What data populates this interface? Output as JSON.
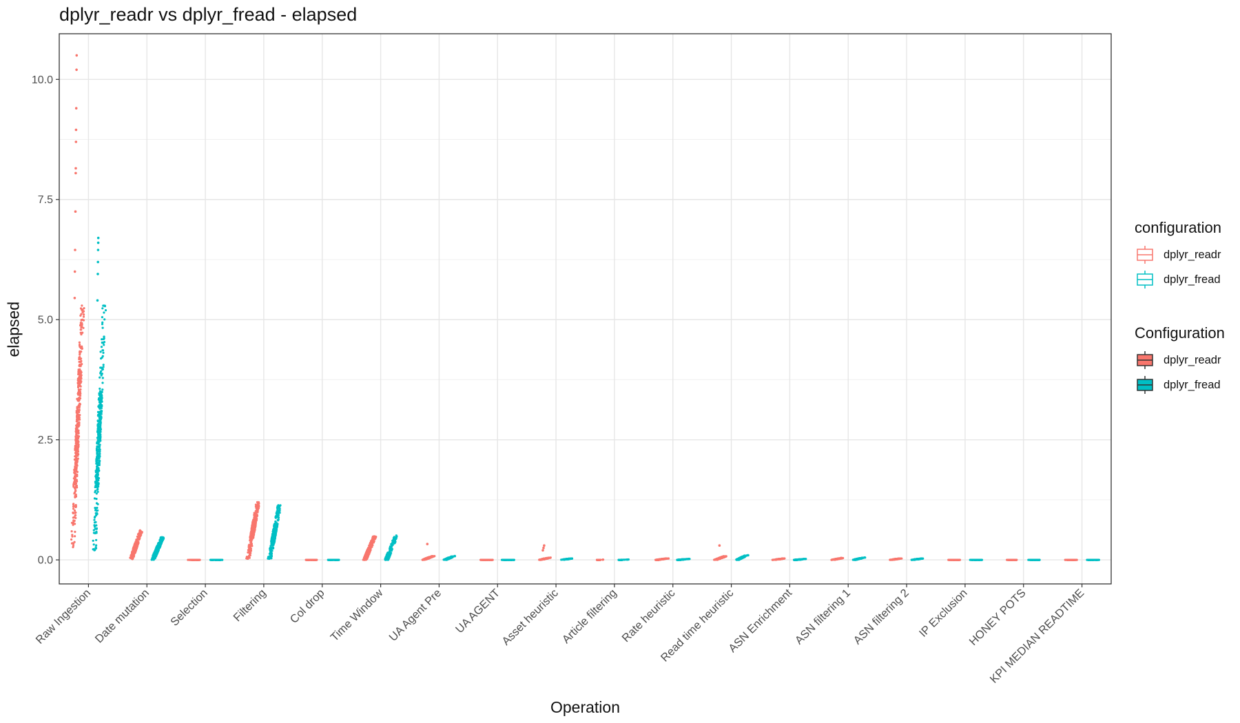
{
  "chart_data": {
    "type": "scatter",
    "title": "dplyr_readr vs dplyr_fread - elapsed",
    "xlabel": "Operation",
    "ylabel": "elapsed",
    "ylim": [
      -0.5,
      10.95
    ],
    "yticks": [
      0.0,
      2.5,
      5.0,
      7.5,
      10.0
    ],
    "ytick_labels": [
      "0.0",
      "2.5",
      "5.0",
      "7.5",
      "10.0"
    ],
    "grid": true,
    "legend_position": "right",
    "categories": [
      "Raw Ingestion",
      "Date mutation",
      "Selection",
      "Filtering",
      "Col drop",
      "Time Window",
      "UA Agent Pre",
      "UA AGENT",
      "Asset heuristic",
      "Article filtering",
      "Rate heuristic",
      "Read time heuristic",
      "ASN Enrichment",
      "ASN filtering 1",
      "ASN filtering 2",
      "IP Exclusion",
      "HONEY POTS",
      "KPI MEDIAN READTIME"
    ],
    "series": [
      {
        "name": "dplyr_readr",
        "color": "#F8766D",
        "ranges": [
          {
            "min": 0.25,
            "q1": 1.5,
            "median": 3.0,
            "q3": 4.0,
            "max": 5.3,
            "outliers": [
              5.45,
              6.0,
              6.45,
              7.25,
              8.05,
              8.15,
              8.7,
              8.95,
              9.4,
              10.2,
              10.5
            ]
          },
          {
            "min": 0.0,
            "q1": 0.15,
            "median": 0.25,
            "q3": 0.35,
            "max": 0.62,
            "outliers": []
          },
          {
            "min": 0.0,
            "q1": 0.0,
            "median": 0.0,
            "q3": 0.0,
            "max": 0.0,
            "outliers": []
          },
          {
            "min": 0.02,
            "q1": 0.45,
            "median": 0.65,
            "q3": 0.85,
            "max": 1.2,
            "outliers": []
          },
          {
            "min": 0.0,
            "q1": 0.0,
            "median": 0.0,
            "q3": 0.0,
            "max": 0.0,
            "outliers": []
          },
          {
            "min": 0.0,
            "q1": 0.05,
            "median": 0.12,
            "q3": 0.22,
            "max": 0.5,
            "outliers": []
          },
          {
            "min": 0.0,
            "q1": 0.02,
            "median": 0.03,
            "q3": 0.05,
            "max": 0.08,
            "outliers": [
              0.33
            ]
          },
          {
            "min": 0.0,
            "q1": 0.0,
            "median": 0.0,
            "q3": 0.0,
            "max": 0.0,
            "outliers": []
          },
          {
            "min": 0.0,
            "q1": 0.01,
            "median": 0.02,
            "q3": 0.03,
            "max": 0.05,
            "outliers": [
              0.2,
              0.25,
              0.3
            ]
          },
          {
            "min": 0.0,
            "q1": 0.0,
            "median": 0.0,
            "q3": 0.0,
            "max": 0.01,
            "outliers": []
          },
          {
            "min": 0.0,
            "q1": 0.0,
            "median": 0.01,
            "q3": 0.02,
            "max": 0.03,
            "outliers": []
          },
          {
            "min": 0.0,
            "q1": 0.02,
            "median": 0.04,
            "q3": 0.06,
            "max": 0.08,
            "outliers": [
              0.3
            ]
          },
          {
            "min": 0.0,
            "q1": 0.01,
            "median": 0.01,
            "q3": 0.02,
            "max": 0.03,
            "outliers": []
          },
          {
            "min": 0.0,
            "q1": 0.01,
            "median": 0.02,
            "q3": 0.03,
            "max": 0.04,
            "outliers": []
          },
          {
            "min": 0.0,
            "q1": 0.01,
            "median": 0.01,
            "q3": 0.02,
            "max": 0.03,
            "outliers": []
          },
          {
            "min": 0.0,
            "q1": 0.0,
            "median": 0.0,
            "q3": 0.0,
            "max": 0.0,
            "outliers": []
          },
          {
            "min": 0.0,
            "q1": 0.0,
            "median": 0.0,
            "q3": 0.0,
            "max": 0.0,
            "outliers": []
          },
          {
            "min": 0.0,
            "q1": 0.0,
            "median": 0.0,
            "q3": 0.0,
            "max": 0.0,
            "outliers": []
          }
        ]
      },
      {
        "name": "dplyr_fread",
        "color": "#00BFC4",
        "ranges": [
          {
            "min": 0.2,
            "q1": 1.5,
            "median": 2.5,
            "q3": 3.5,
            "max": 5.3,
            "outliers": [
              5.4,
              5.95,
              6.2,
              6.45,
              6.6,
              6.7
            ]
          },
          {
            "min": 0.0,
            "q1": 0.08,
            "median": 0.18,
            "q3": 0.3,
            "max": 0.48,
            "outliers": []
          },
          {
            "min": 0.0,
            "q1": 0.0,
            "median": 0.0,
            "q3": 0.0,
            "max": 0.0,
            "outliers": []
          },
          {
            "min": 0.02,
            "q1": 0.35,
            "median": 0.55,
            "q3": 0.75,
            "max": 1.15,
            "outliers": []
          },
          {
            "min": 0.0,
            "q1": 0.0,
            "median": 0.0,
            "q3": 0.0,
            "max": 0.0,
            "outliers": []
          },
          {
            "min": 0.0,
            "q1": 0.03,
            "median": 0.08,
            "q3": 0.15,
            "max": 0.52,
            "outliers": []
          },
          {
            "min": 0.0,
            "q1": 0.01,
            "median": 0.03,
            "q3": 0.05,
            "max": 0.09,
            "outliers": []
          },
          {
            "min": 0.0,
            "q1": 0.0,
            "median": 0.0,
            "q3": 0.0,
            "max": 0.0,
            "outliers": []
          },
          {
            "min": 0.0,
            "q1": 0.01,
            "median": 0.01,
            "q3": 0.02,
            "max": 0.03,
            "outliers": []
          },
          {
            "min": 0.0,
            "q1": 0.0,
            "median": 0.0,
            "q3": 0.0,
            "max": 0.01,
            "outliers": []
          },
          {
            "min": 0.0,
            "q1": 0.0,
            "median": 0.01,
            "q3": 0.01,
            "max": 0.02,
            "outliers": []
          },
          {
            "min": 0.0,
            "q1": 0.02,
            "median": 0.04,
            "q3": 0.06,
            "max": 0.1,
            "outliers": []
          },
          {
            "min": 0.0,
            "q1": 0.0,
            "median": 0.01,
            "q3": 0.01,
            "max": 0.02,
            "outliers": []
          },
          {
            "min": 0.0,
            "q1": 0.01,
            "median": 0.02,
            "q3": 0.03,
            "max": 0.05,
            "outliers": []
          },
          {
            "min": 0.0,
            "q1": 0.01,
            "median": 0.01,
            "q3": 0.02,
            "max": 0.03,
            "outliers": []
          },
          {
            "min": 0.0,
            "q1": 0.0,
            "median": 0.0,
            "q3": 0.0,
            "max": 0.0,
            "outliers": []
          },
          {
            "min": 0.0,
            "q1": 0.0,
            "median": 0.0,
            "q3": 0.0,
            "max": 0.0,
            "outliers": []
          },
          {
            "min": 0.0,
            "q1": 0.0,
            "median": 0.0,
            "q3": 0.0,
            "max": 0.0,
            "outliers": []
          }
        ]
      }
    ],
    "legends": [
      {
        "title": "configuration",
        "style": "outline",
        "entries": [
          {
            "name": "dplyr_readr",
            "color": "#F8766D"
          },
          {
            "name": "dplyr_fread",
            "color": "#00BFC4"
          }
        ]
      },
      {
        "title": "Configuration",
        "style": "filled",
        "entries": [
          {
            "name": "dplyr_readr",
            "color": "#F8766D"
          },
          {
            "name": "dplyr_fread",
            "color": "#00BFC4"
          }
        ]
      }
    ]
  }
}
